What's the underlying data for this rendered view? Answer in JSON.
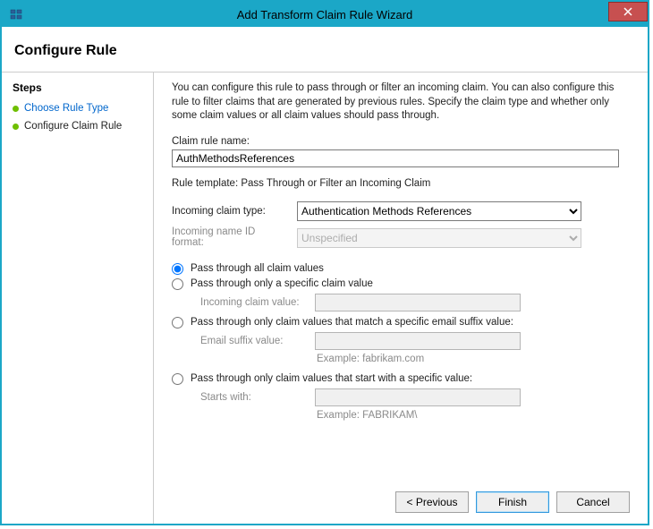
{
  "window": {
    "title": "Add Transform Claim Rule Wizard"
  },
  "header": {
    "title": "Configure Rule"
  },
  "sidebar": {
    "title": "Steps",
    "items": [
      {
        "label": "Choose Rule Type",
        "active": false
      },
      {
        "label": "Configure Claim Rule",
        "active": true
      }
    ]
  },
  "main": {
    "description": "You can configure this rule to pass through or filter an incoming claim. You can also configure this rule to filter claims that are generated by previous rules. Specify the claim type and whether only some claim values or all claim values should pass through.",
    "claim_rule_name_label": "Claim rule name:",
    "claim_rule_name_value": "AuthMethodsReferences",
    "rule_template_text": "Rule template: Pass Through or Filter an Incoming Claim",
    "incoming_claim_type_label": "Incoming claim type:",
    "incoming_claim_type_value": "Authentication Methods References",
    "incoming_name_id_label": "Incoming name ID format:",
    "incoming_name_id_value": "Unspecified",
    "radios": {
      "all": "Pass through all claim values",
      "specific": "Pass through only a specific claim value",
      "specific_sub_label": "Incoming claim value:",
      "email": "Pass through only claim values that match a specific email suffix value:",
      "email_sub_label": "Email suffix value:",
      "email_hint": "Example: fabrikam.com",
      "starts": "Pass through only claim values that start with a specific value:",
      "starts_sub_label": "Starts with:",
      "starts_hint": "Example: FABRIKAM\\"
    }
  },
  "footer": {
    "previous": "< Previous",
    "finish": "Finish",
    "cancel": "Cancel"
  }
}
